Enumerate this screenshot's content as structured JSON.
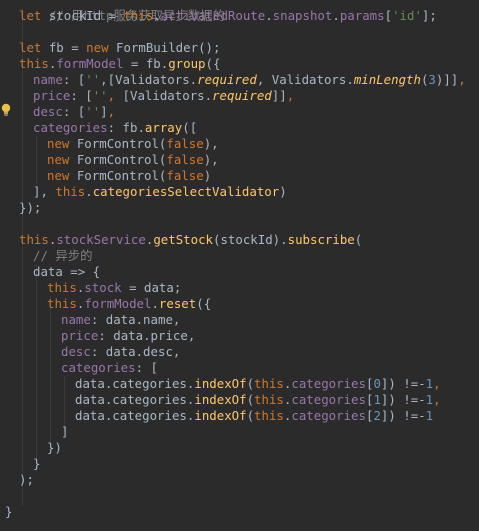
{
  "code": {
    "l0_comment": "// 用http服务获取异步数据的",
    "l1_let": "let",
    "l1_var": " stockId = ",
    "l1_this": "this",
    "l1_dot": ".",
    "l1_f1": "activatedRoute",
    "l1_f2": "snapshot",
    "l1_f3": "params",
    "l1_open": "[",
    "l1_str": "'id'",
    "l1_close": "];",
    "l3_let": "let",
    "l3_var": " fb = ",
    "l3_new": "new",
    "l3_rest": " FormBuilder();",
    "l4_this": "this",
    "l4_dot": ".",
    "l4_fld": "formModel",
    "l4_mid": " = fb.",
    "l4_fn": "group",
    "l4_end": "({",
    "l5_key": "name",
    "l5_a": ": [",
    "l5_s": "''",
    "l5_b": ",[Validators.",
    "l5_req": "required",
    "l5_c": ", Validators.",
    "l5_min": "minLength",
    "l5_d": "(",
    "l5_n": "3",
    "l5_e": ")]]",
    "l5_comma": ",",
    "l6_key": "price",
    "l6_a": ": [",
    "l6_s": "''",
    "l6_comma1": ",",
    "l6_b": " [Validators.",
    "l6_req": "required",
    "l6_e": "]]",
    "l6_comma": ",",
    "l7_key": "desc",
    "l7_a": ": [",
    "l7_s": "''",
    "l7_e": "]",
    "l7_comma": ",",
    "l8_key": "categories",
    "l8_a": ": fb.",
    "l8_fn": "array",
    "l8_e": "([",
    "fc_new": "new",
    "fc_mid": " FormControl(",
    "fc_false": "false",
    "fc_end": "),",
    "fc_end_last": ")",
    "l12_a": "], ",
    "l12_this": "this",
    "l12_dot": ".",
    "l12_fn": "categoriesSelectValidator",
    "l12_e": ")",
    "l13": "});",
    "l15_this": "this",
    "l15_dot": ".",
    "l15_fld": "stockService",
    "l15_dot2": ".",
    "l15_fn": "getStock",
    "l15_mid": "(stockId).",
    "l15_fn2": "subscribe",
    "l15_e": "(",
    "l16_comment": "// 异步的",
    "l17": "data => {",
    "l18_this": "this",
    "l18_dot": ".",
    "l18_fld": "stock",
    "l18_e": " = data;",
    "l19_this": "this",
    "l19_dot": ".",
    "l19_fld": "formModel",
    "l19_dot2": ".",
    "l19_fn": "reset",
    "l19_e": "({",
    "l20_key": "name",
    "l20_e": ": data.name,",
    "l21_key": "price",
    "l21_e": ": data.price,",
    "l22_key": "desc",
    "l22_e": ": data.desc,",
    "l23_key": "categories",
    "l23_e": ": [",
    "cat_a": "data.categories.",
    "cat_fn": "indexOf",
    "cat_b": "(",
    "cat_this": "this",
    "cat_dot": ".",
    "cat_fld": "categories",
    "cat_c": "[",
    "cat_i0": "0",
    "cat_i1": "1",
    "cat_i2": "2",
    "cat_d": "]) !=-",
    "cat_one": "1",
    "cat_comma": ",",
    "l27": "]",
    "l28": "})",
    "l29": "}",
    "l30": ");",
    "l32": "}"
  },
  "icons": {
    "hint": "lightbulb-icon"
  },
  "colors": {
    "background": "#2b2b2b",
    "keyword": "#cc7832",
    "field": "#9876aa",
    "function": "#ffc66d",
    "string": "#6a8759",
    "number": "#6897bb",
    "comment": "#808080",
    "text": "#a9b7c6"
  }
}
